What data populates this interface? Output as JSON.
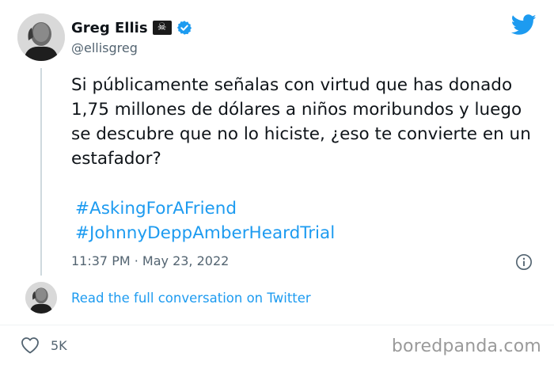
{
  "author": {
    "name": "Greg Ellis",
    "flag_emoji": "☠",
    "handle": "@ellisgreg"
  },
  "tweet": {
    "text": "Si públicamente señalas con virtud que has donado 1,75 millones de dólares a niños moribundos y luego se descubre que no lo hiciste, ¿eso te convierte en un estafador?",
    "hashtags": [
      "#AskingForAFriend",
      "#JohnnyDeppAmberHeardTrial"
    ],
    "timestamp": "11:37 PM · May 23, 2022"
  },
  "conversation_link": "Read the full conversation on Twitter",
  "likes": "5K",
  "watermark": "boredpanda.com",
  "colors": {
    "accent": "#1d9bf0",
    "text": "#0f1419",
    "secondary": "#536471"
  },
  "icons": [
    "twitter-bird-icon",
    "verified-badge-icon",
    "info-icon",
    "heart-icon"
  ]
}
